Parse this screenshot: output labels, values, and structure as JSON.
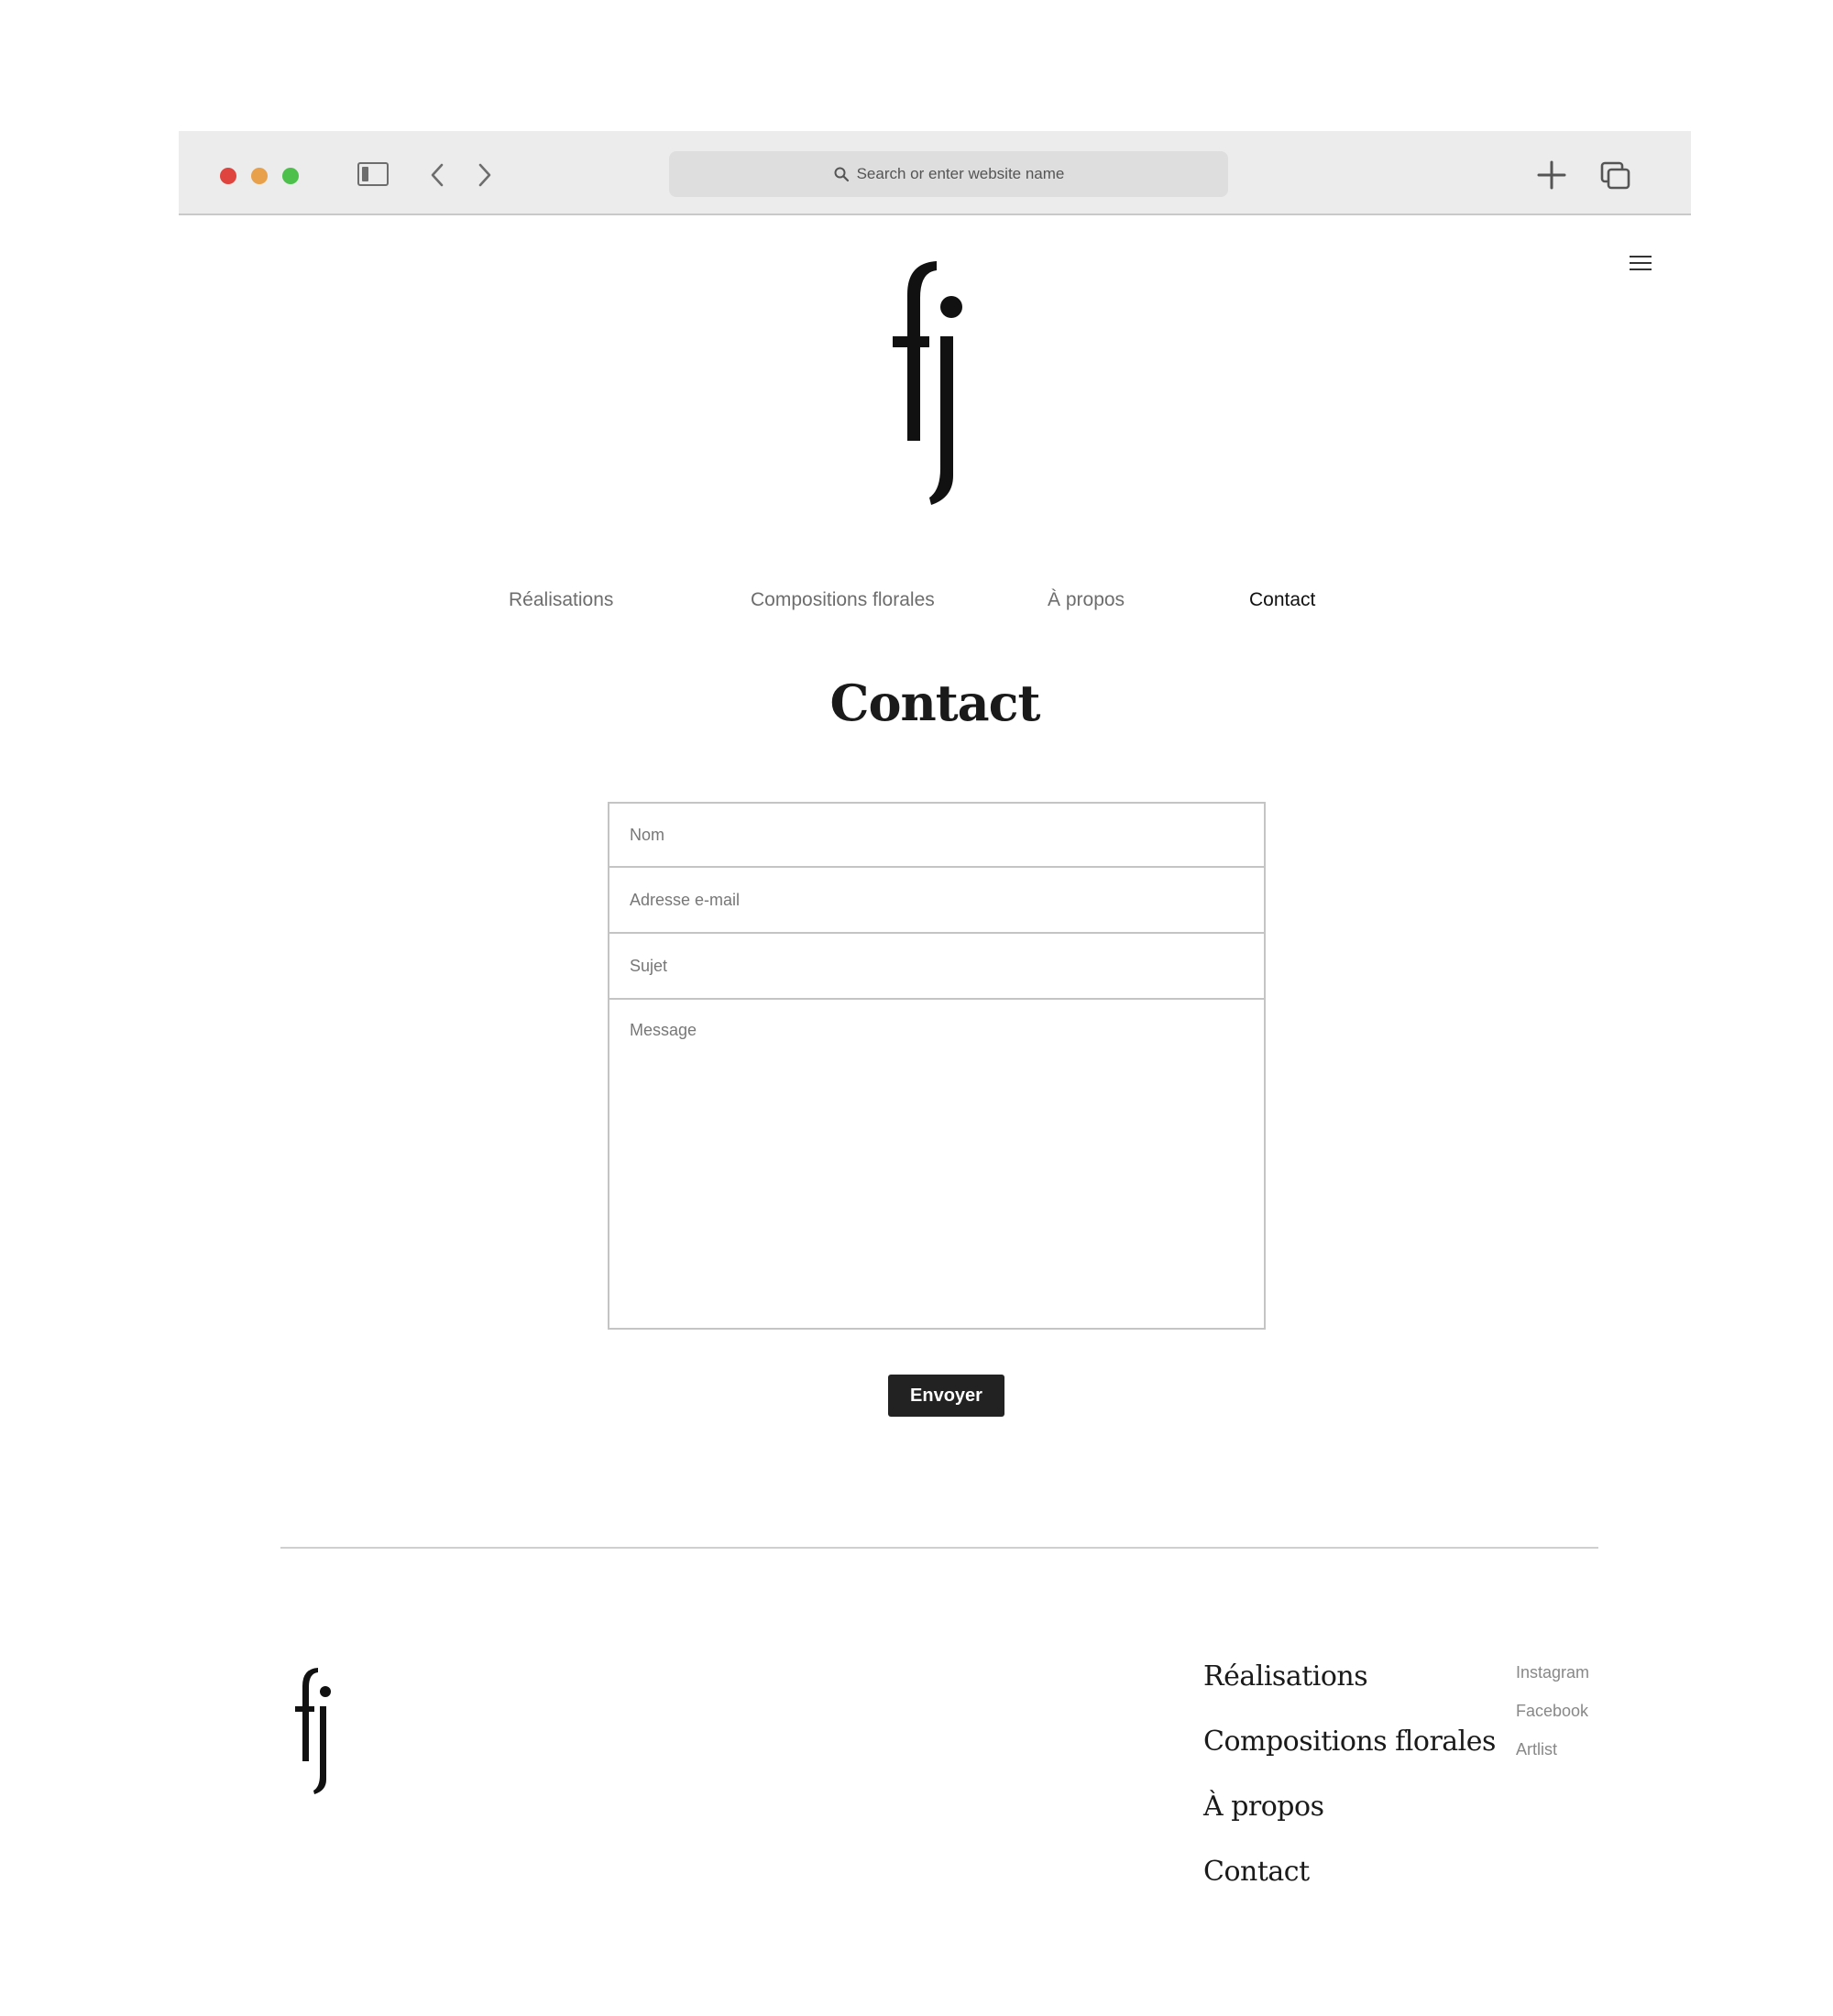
{
  "browser": {
    "address_placeholder": "Search or enter website name"
  },
  "site": {
    "nav": [
      {
        "label": "Réalisations",
        "active": false
      },
      {
        "label": "Compositions florales",
        "active": false
      },
      {
        "label": "À propos",
        "active": false
      },
      {
        "label": "Contact",
        "active": true
      }
    ]
  },
  "contact": {
    "title": "Contact",
    "fields": {
      "name_placeholder": "Nom",
      "email_placeholder": "Adresse e-mail",
      "subject_placeholder": "Sujet",
      "message_placeholder": "Message"
    },
    "submit_label": "Envoyer"
  },
  "footer": {
    "nav": [
      "Réalisations",
      "Compositions florales",
      "À propos",
      "Contact"
    ],
    "social": [
      "Instagram",
      "Facebook",
      "Artlist"
    ]
  }
}
